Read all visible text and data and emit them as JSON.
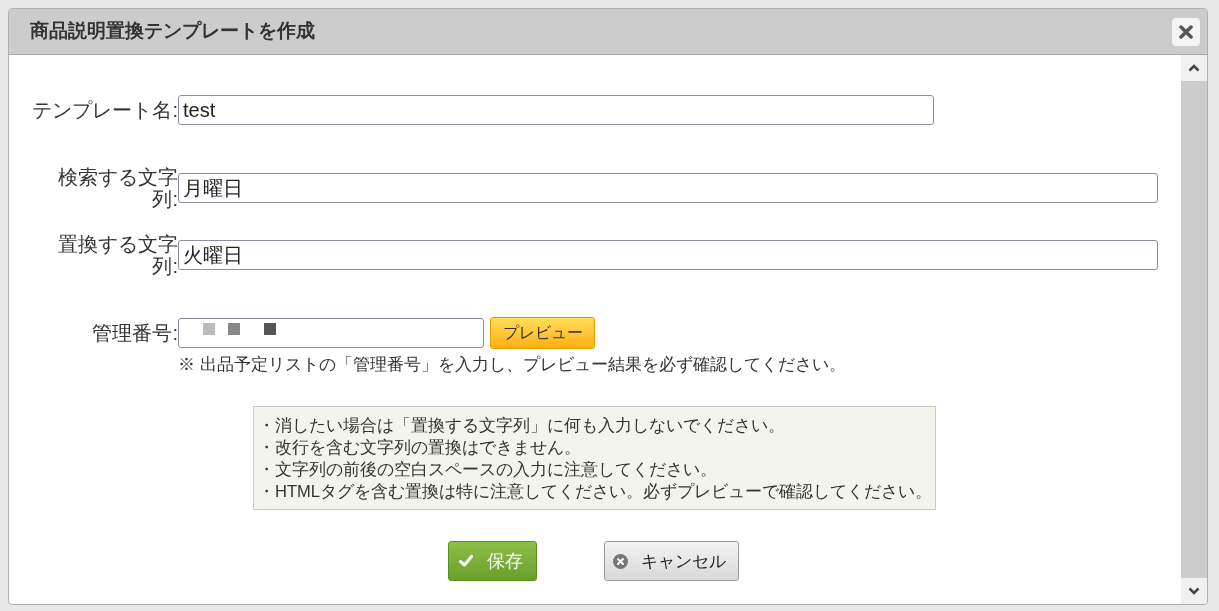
{
  "dialog": {
    "title": "商品説明置換テンプレートを作成"
  },
  "fields": [
    {
      "kind": "short",
      "label": "テンプレート名:",
      "value": "test"
    },
    {
      "kind": "long",
      "label": "検索する文字列:",
      "value": "月曜日"
    },
    {
      "kind": "long",
      "label": "置換する文字列:",
      "value": "火曜日"
    },
    {
      "kind": "lookup",
      "label": "管理番号:",
      "masked": true,
      "button": "プレビュー",
      "note": "※ 出品予定リストの「管理番号」を入力し、プレビュー結果を必ず確認してください。"
    }
  ],
  "notices": [
    "・消したい場合は「置換する文字列」に何も入力しないでください。",
    "・改行を含む文字列の置換はできません。",
    "・文字列の前後の空白スペースの入力に注意してください。",
    "・HTMLタグを含む置換は特に注意してください。必ずプレビューで確認してください。"
  ],
  "buttons": [
    {
      "kind": "save",
      "label": "保存"
    },
    {
      "kind": "cancel",
      "label": "キャンセル"
    }
  ]
}
